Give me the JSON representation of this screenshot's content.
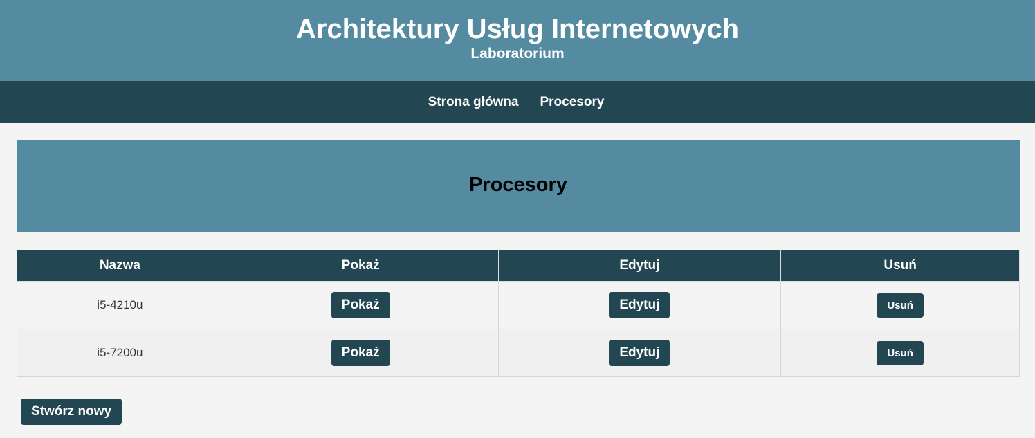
{
  "header": {
    "title": "Architektury Usług Internetowych",
    "subtitle": "Laboratorium"
  },
  "nav": {
    "items": [
      {
        "label": "Strona główna"
      },
      {
        "label": "Procesory"
      }
    ]
  },
  "main": {
    "title": "Procesory",
    "table": {
      "columns": [
        "Nazwa",
        "Pokaż",
        "Edytuj",
        "Usuń"
      ],
      "rows": [
        {
          "name": "i5-4210u",
          "show_label": "Pokaż",
          "edit_label": "Edytuj",
          "delete_label": "Usuń"
        },
        {
          "name": "i5-7200u",
          "show_label": "Pokaż",
          "edit_label": "Edytuj",
          "delete_label": "Usuń"
        }
      ]
    },
    "create_label": "Stwórz nowy"
  },
  "colors": {
    "header_bg": "#548ba1",
    "nav_bg": "#224753",
    "button_bg": "#224753",
    "page_bg": "#f4f4f4"
  }
}
